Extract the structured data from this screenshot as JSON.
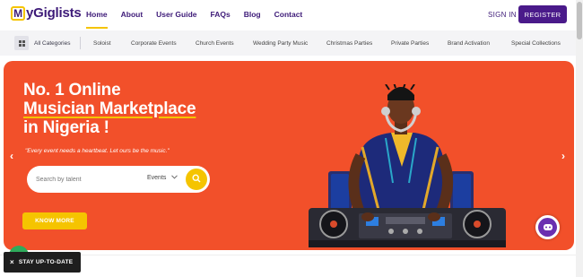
{
  "header": {
    "logo_text": "MyGiglists",
    "logo_mark": "M",
    "logo_rest": "yGiglists",
    "nav": [
      "Home",
      "About",
      "User Guide",
      "FAQs",
      "Blog",
      "Contact"
    ],
    "active_nav": "Home",
    "signin_label": "SIGN IN",
    "register_label": "REGISTER"
  },
  "categories": {
    "all_label": "All Categories",
    "items": [
      "Soloist",
      "Corporate Events",
      "Church Events",
      "Wedding Party Music",
      "Christmas Parties",
      "Private Parties",
      "Brand Activation",
      "Special Collections"
    ]
  },
  "hero": {
    "title_line1": "No. 1 Online",
    "title_line2": "Musician Marketplace",
    "title_line3": "in Nigeria !",
    "tagline": "\"Every event needs a heartbeat. Let ours be the music.\"",
    "search_placeholder": "Search by talent",
    "events_label": "Events",
    "know_more_label": "KNOW MORE",
    "prev_arrow": "‹",
    "next_arrow": "›"
  },
  "newsletter": {
    "close_symbol": "×",
    "label": "STAY UP-TO-DATE"
  },
  "colors": {
    "brand_purple": "#4a1a8a",
    "hero_orange": "#f2502a",
    "accent_yellow": "#f5c400"
  },
  "icons": {
    "category_menu": "grid-icon",
    "search": "search-icon",
    "dropdown": "chevron-down-icon",
    "chat": "chat-icon"
  }
}
